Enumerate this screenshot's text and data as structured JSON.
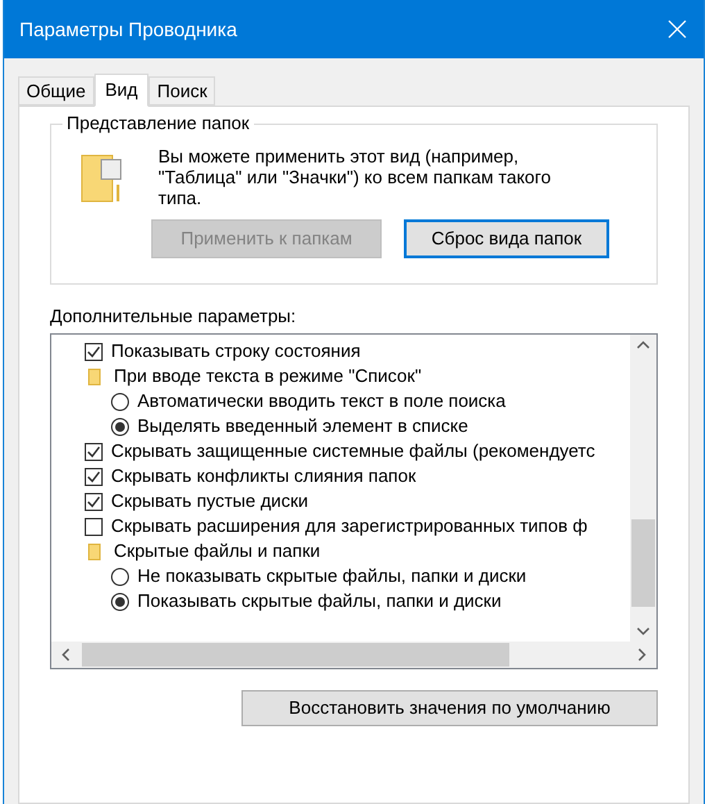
{
  "window": {
    "title": "Параметры Проводника"
  },
  "tabs": [
    {
      "label": "Общие",
      "selected": false
    },
    {
      "label": "Вид",
      "selected": true
    },
    {
      "label": "Поиск",
      "selected": false
    }
  ],
  "folder_views": {
    "title": "Представление папок",
    "description": "Вы можете применить этот вид (например, \"Таблица\" или \"Значки\") ко всем папкам такого типа.",
    "buttons": [
      {
        "label": "Применить к папкам",
        "disabled": true
      },
      {
        "label": "Сброс вида папок",
        "disabled": false
      }
    ]
  },
  "advanced": {
    "label": "Дополнительные параметры:",
    "items": [
      {
        "kind": "checkbox",
        "label": "Показывать строку состояния",
        "checked": true
      },
      {
        "kind": "folder",
        "label": "При вводе текста в режиме \"Список\"",
        "children": [
          {
            "kind": "radio",
            "label": "Автоматически вводить текст в поле поиска",
            "selected": false
          },
          {
            "kind": "radio",
            "label": "Выделять введенный элемент в списке",
            "selected": true
          }
        ]
      },
      {
        "kind": "checkbox",
        "label": "Скрывать защищенные системные файлы (рекомендуетс",
        "checked": true
      },
      {
        "kind": "checkbox",
        "label": "Скрывать конфликты слияния папок",
        "checked": true
      },
      {
        "kind": "checkbox",
        "label": "Скрывать пустые диски",
        "checked": true
      },
      {
        "kind": "checkbox",
        "label": "Скрывать расширения для зарегистрированных типов ф",
        "checked": false
      },
      {
        "kind": "folder",
        "label": "Скрытые файлы и папки",
        "children": [
          {
            "kind": "radio",
            "label": "Не показывать скрытые файлы, папки и диски",
            "selected": false
          },
          {
            "kind": "radio",
            "label": "Показывать скрытые файлы, папки и диски",
            "selected": true
          }
        ]
      }
    ]
  },
  "restore_button": "Восстановить значения по умолчанию"
}
